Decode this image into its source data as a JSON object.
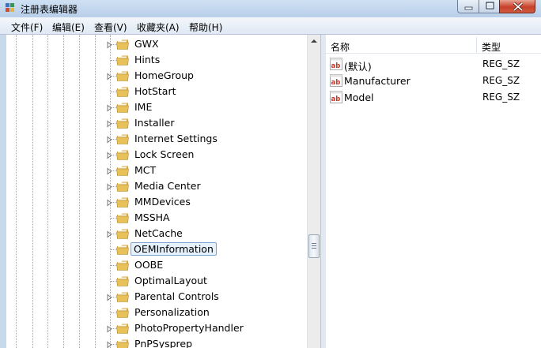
{
  "window": {
    "title": "注册表编辑器"
  },
  "menu": [
    "文件(F)",
    "编辑(E)",
    "查看(V)",
    "收藏夹(A)",
    "帮助(H)"
  ],
  "tree": {
    "nodes": [
      {
        "label": "GWX",
        "expandable": true
      },
      {
        "label": "Hints",
        "expandable": false
      },
      {
        "label": "HomeGroup",
        "expandable": true
      },
      {
        "label": "HotStart",
        "expandable": false
      },
      {
        "label": "IME",
        "expandable": true
      },
      {
        "label": "Installer",
        "expandable": true
      },
      {
        "label": "Internet Settings",
        "expandable": true
      },
      {
        "label": "Lock Screen",
        "expandable": true
      },
      {
        "label": "MCT",
        "expandable": true
      },
      {
        "label": "Media Center",
        "expandable": true
      },
      {
        "label": "MMDevices",
        "expandable": true
      },
      {
        "label": "MSSHA",
        "expandable": false
      },
      {
        "label": "NetCache",
        "expandable": true
      },
      {
        "label": "OEMInformation",
        "expandable": false,
        "selected": true
      },
      {
        "label": "OOBE",
        "expandable": false
      },
      {
        "label": "OptimalLayout",
        "expandable": false
      },
      {
        "label": "Parental Controls",
        "expandable": true
      },
      {
        "label": "Personalization",
        "expandable": false
      },
      {
        "label": "PhotoPropertyHandler",
        "expandable": true
      },
      {
        "label": "PnPSysprep",
        "expandable": true
      }
    ]
  },
  "list": {
    "columns": {
      "name": "名称",
      "type": "类型"
    },
    "rows": [
      {
        "name": "(默认)",
        "type": "REG_SZ"
      },
      {
        "name": "Manufacturer",
        "type": "REG_SZ"
      },
      {
        "name": "Model",
        "type": "REG_SZ"
      }
    ]
  },
  "colors": {
    "titlebar": "#c9d9ec",
    "selection_border": "#7da2ce",
    "folder": "#e8c15a",
    "close_button": "#c7402a"
  },
  "icons": {
    "app": "regedit-icon",
    "folder": "folder-icon",
    "value": "reg-string-value-icon",
    "expander": "expand-arrow-icon"
  }
}
